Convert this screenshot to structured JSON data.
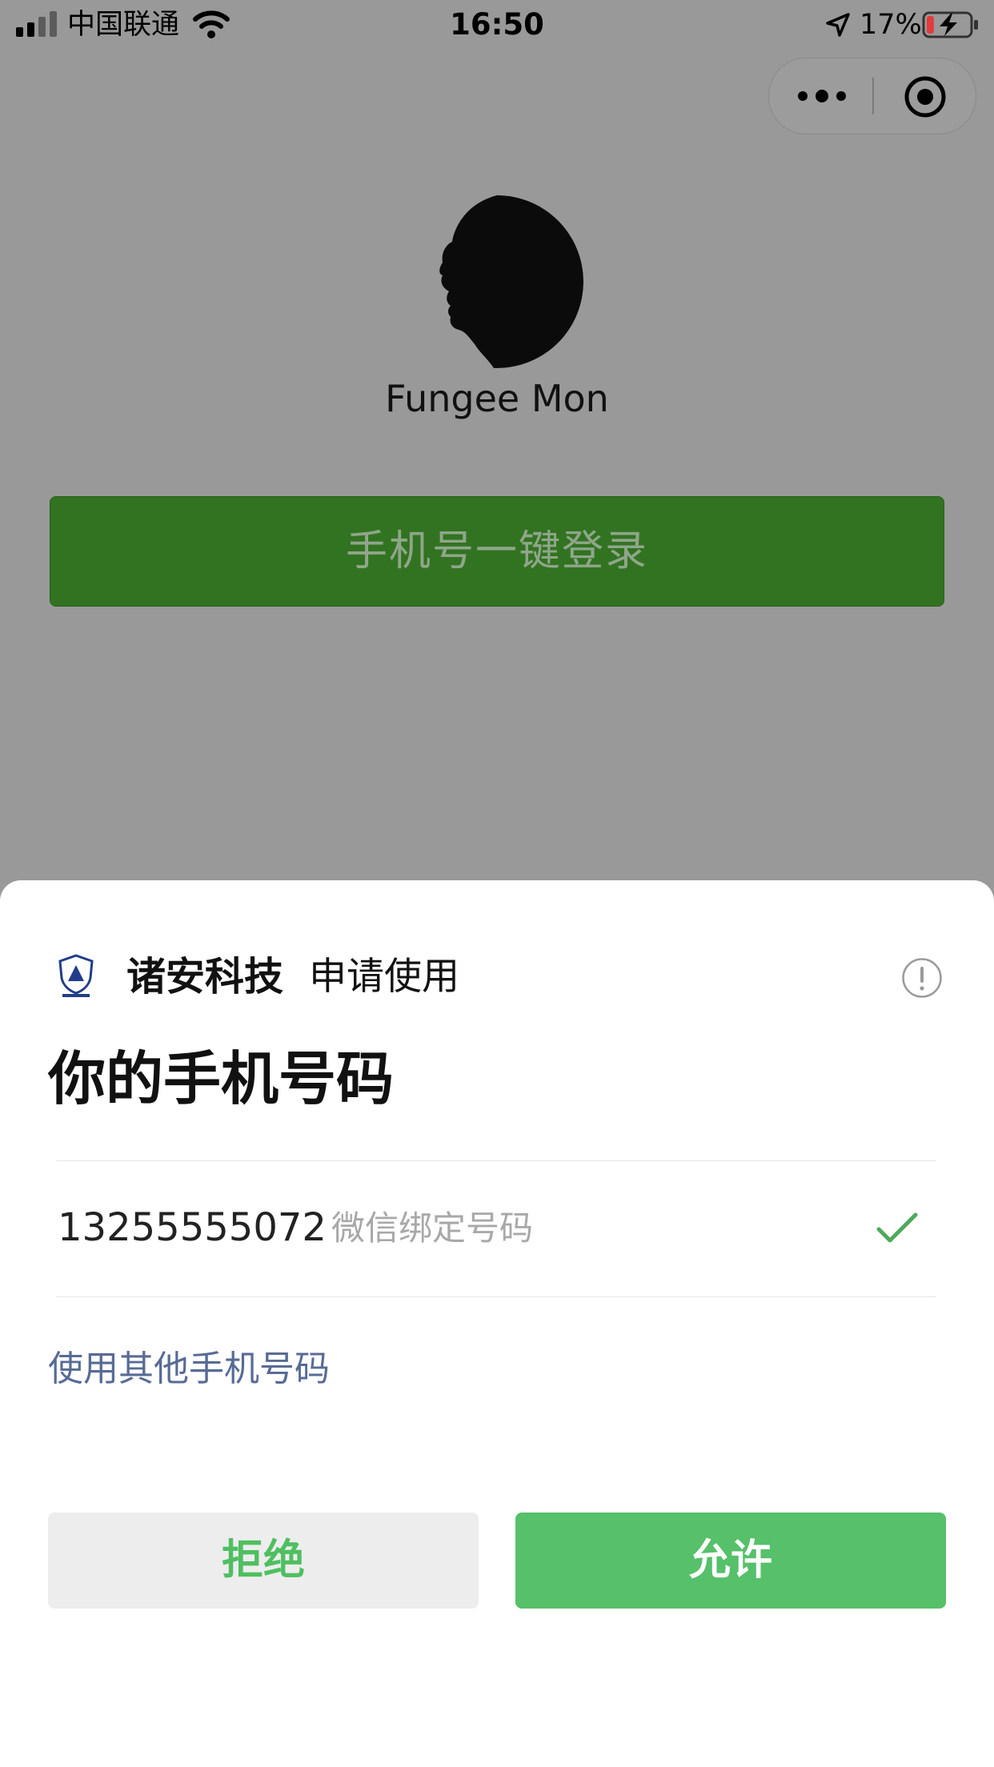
{
  "status_bar": {
    "carrier": "中国联通",
    "time": "16:50",
    "battery_percent": "17%",
    "battery_level": 0.17
  },
  "header": {
    "more_icon": "more-dots-icon",
    "close_icon": "target-close-icon"
  },
  "profile": {
    "name": "Fungee Mon"
  },
  "login_button": {
    "label": "手机号一键登录"
  },
  "sheet": {
    "app_name": "诸安科技",
    "request_text": "申请使用",
    "title": "你的手机号码",
    "phone": {
      "number": "13255555072",
      "description": "微信绑定号码",
      "selected": true
    },
    "other_phone_link": "使用其他手机号码",
    "reject_label": "拒绝",
    "allow_label": "允许"
  },
  "colors": {
    "overlay_bg": "#999999",
    "login_green": "#327321",
    "allow_green": "#56c06a",
    "link_blue": "#576b95"
  }
}
